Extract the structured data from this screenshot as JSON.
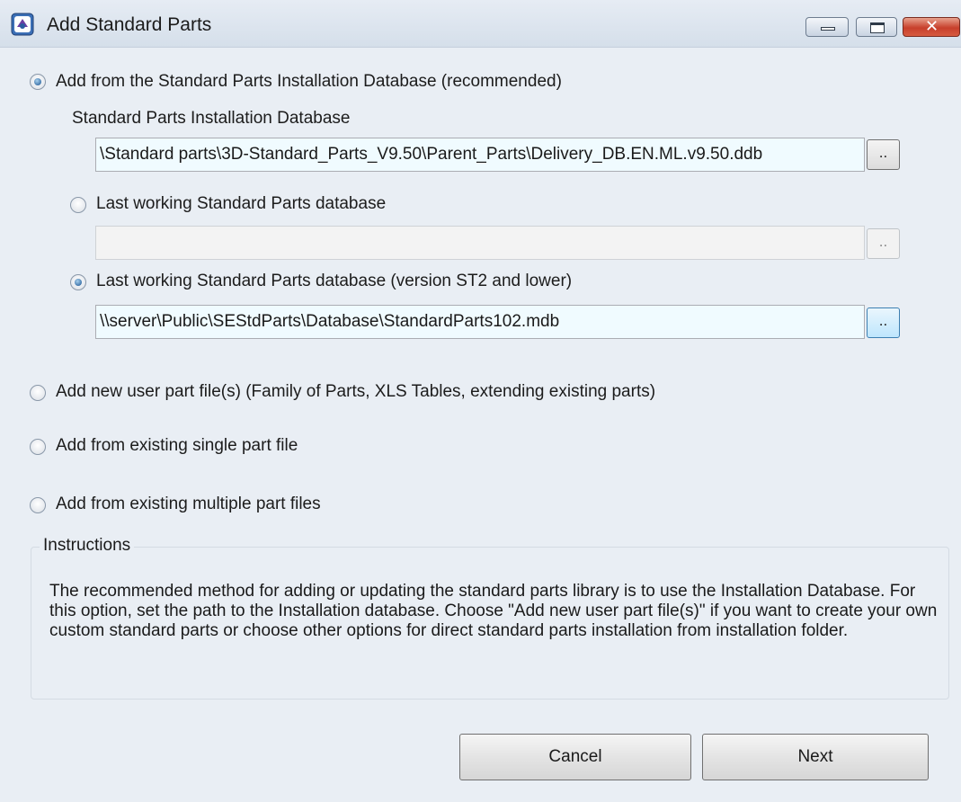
{
  "window": {
    "title": "Add Standard Parts",
    "close_glyph": "✕"
  },
  "options": {
    "installation_db": {
      "label": "Add from the Standard Parts Installation Database (recommended)",
      "checked": true,
      "sublabel": "Standard Parts Installation Database",
      "path": "\\Standard parts\\3D-Standard_Parts_V9.50\\Parent_Parts\\Delivery_DB.EN.ML.v9.50.ddb",
      "browse_label": ".."
    },
    "last_working_db": {
      "label": "Last working Standard Parts database",
      "checked": false,
      "path": "",
      "browse_label": ".."
    },
    "last_working_db_legacy": {
      "label": "Last working Standard Parts database (version ST2 and lower)",
      "checked": true,
      "path": "\\\\server\\Public\\SEStdParts\\Database\\StandardParts102.mdb",
      "browse_label": ".."
    },
    "new_user_part": {
      "label": "Add new user part file(s) (Family of Parts, XLS Tables, extending existing parts)",
      "checked": false
    },
    "single_part": {
      "label": "Add from existing single part file",
      "checked": false
    },
    "multiple_parts": {
      "label": "Add from existing multiple part files",
      "checked": false
    }
  },
  "instructions": {
    "title": "Instructions",
    "text": "The recommended method for adding or updating the standard parts library is to use the Installation Database. For this option, set the path to the Installation database. Choose \"Add new user part file(s)\" if you want to create your own custom standard parts or choose other options for direct standard parts installation from installation folder."
  },
  "buttons": {
    "cancel": "Cancel",
    "next": "Next"
  },
  "icons": {
    "app": "standard-parts-app-icon",
    "minimize": "minimize-icon",
    "maximize": "maximize-icon",
    "close": "close-icon"
  },
  "colors": {
    "background": "#e9eef4",
    "radio_dot": "#15508f",
    "close_button": "#c7402c"
  }
}
